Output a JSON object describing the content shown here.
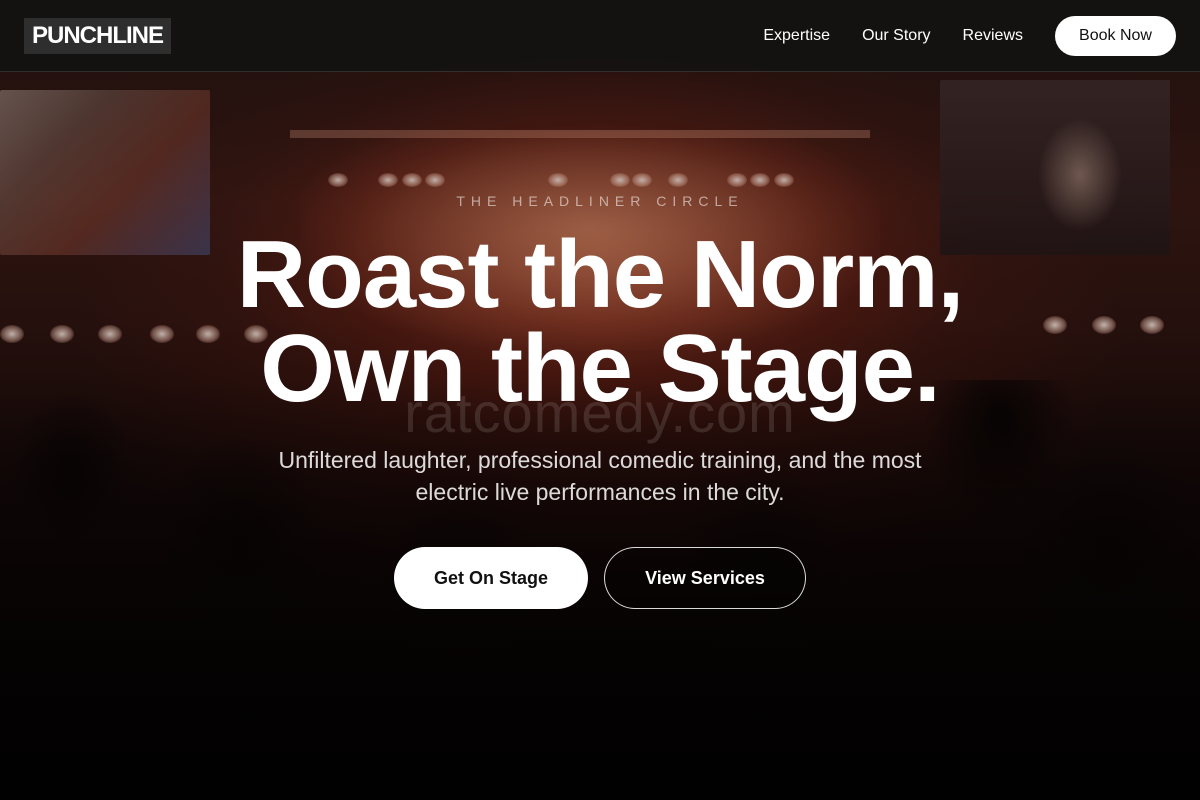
{
  "nav": {
    "logo": "PUNCHLINE",
    "links": [
      {
        "label": "Expertise"
      },
      {
        "label": "Our Story"
      },
      {
        "label": "Reviews"
      }
    ],
    "book_label": "Book Now"
  },
  "hero": {
    "eyebrow": "THE HEADLINER CIRCLE",
    "headline_line1": "Roast the Norm,",
    "headline_line2": "Own the Stage.",
    "watermark": "ratcomedy.com",
    "subtitle": "Unfiltered laughter, professional comedic training, and the most electric live performances in the city.",
    "primary_cta": "Get On Stage",
    "secondary_cta": "View Services"
  }
}
